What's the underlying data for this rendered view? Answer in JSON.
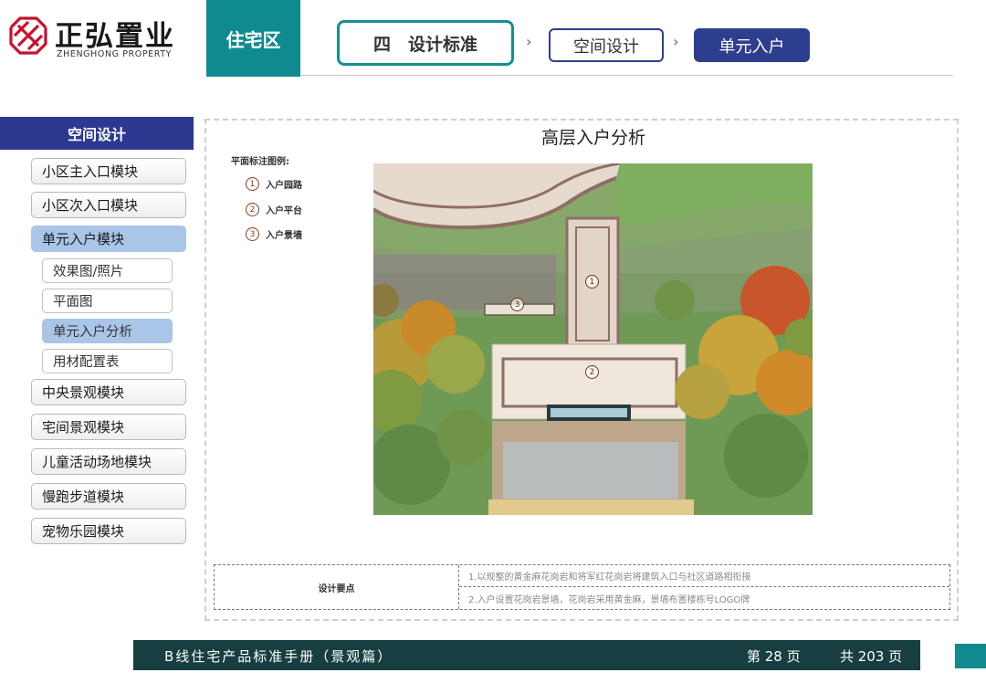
{
  "brand": {
    "name_cn": "正弘置业",
    "name_en": "ZHENGHONG PROPERTY",
    "color": "#c8102e"
  },
  "header": {
    "zone": "住宅区",
    "breadcrumb": {
      "section": "四　设计标准",
      "parent": "空间设计",
      "current": "单元入户"
    },
    "separator": "›"
  },
  "sidebar": {
    "title": "空间设计",
    "items": [
      {
        "label": "小区主入口模块"
      },
      {
        "label": "小区次入口模块"
      },
      {
        "label": "单元入户模块",
        "active": true
      },
      {
        "label": "中央景观模块"
      },
      {
        "label": "宅间景观模块"
      },
      {
        "label": "儿童活动场地模块"
      },
      {
        "label": "慢跑步道模块"
      },
      {
        "label": "宠物乐园模块"
      }
    ],
    "subitems": [
      {
        "label": "效果图/照片"
      },
      {
        "label": "平面图"
      },
      {
        "label": "单元入户分析",
        "active": true
      },
      {
        "label": "用材配置表"
      }
    ]
  },
  "main": {
    "title": "高层入户分析",
    "legend": {
      "title": "平面标注图例:",
      "items": [
        {
          "num": "1",
          "label": "入户园路"
        },
        {
          "num": "2",
          "label": "入户平台"
        },
        {
          "num": "3",
          "label": "入户景墙"
        }
      ]
    },
    "plan_markers": [
      "1",
      "2",
      "3"
    ],
    "requirements": {
      "label": "设计要点",
      "rows": [
        "1.以规整的黄金麻花岗岩和将军红花岗岩将建筑入口与社区道路相衔接",
        "2.入户设置花岗岩景墙，花岗岩采用黄金麻，景墙布置楼栋号LOGO牌"
      ]
    }
  },
  "footer": {
    "title": "B线住宅产品标准手册（景观篇）",
    "page": "第  28  页",
    "total": "共 203 页"
  },
  "colors": {
    "teal": "#0f8b8f",
    "navy": "#2b3990",
    "footer": "#173e40",
    "active": "#a9c5e8"
  }
}
